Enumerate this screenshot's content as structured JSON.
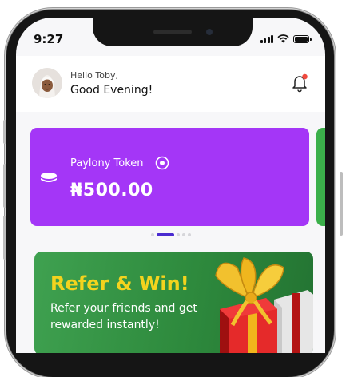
{
  "status_bar": {
    "time": "9:27"
  },
  "header": {
    "greeting_small": "Hello Toby,",
    "greeting_big": "Good Evening!",
    "avatar": "avatar-icon",
    "notification_icon": "bell-icon",
    "notification_badge_color": "#f0493e"
  },
  "wallet_card": {
    "label": "Paylony Token",
    "amount": "₦500.00",
    "color": "#a436f7",
    "next_card_color": "#3bb04a"
  },
  "carousel": {
    "count": 5,
    "active": 2,
    "active_color": "#4a2bd0"
  },
  "promo": {
    "title": "Refer & Win!",
    "subtitle": "Refer your friends and get rewarded instantly!",
    "title_color": "#f3d31e",
    "background": "#2e8a3d"
  }
}
